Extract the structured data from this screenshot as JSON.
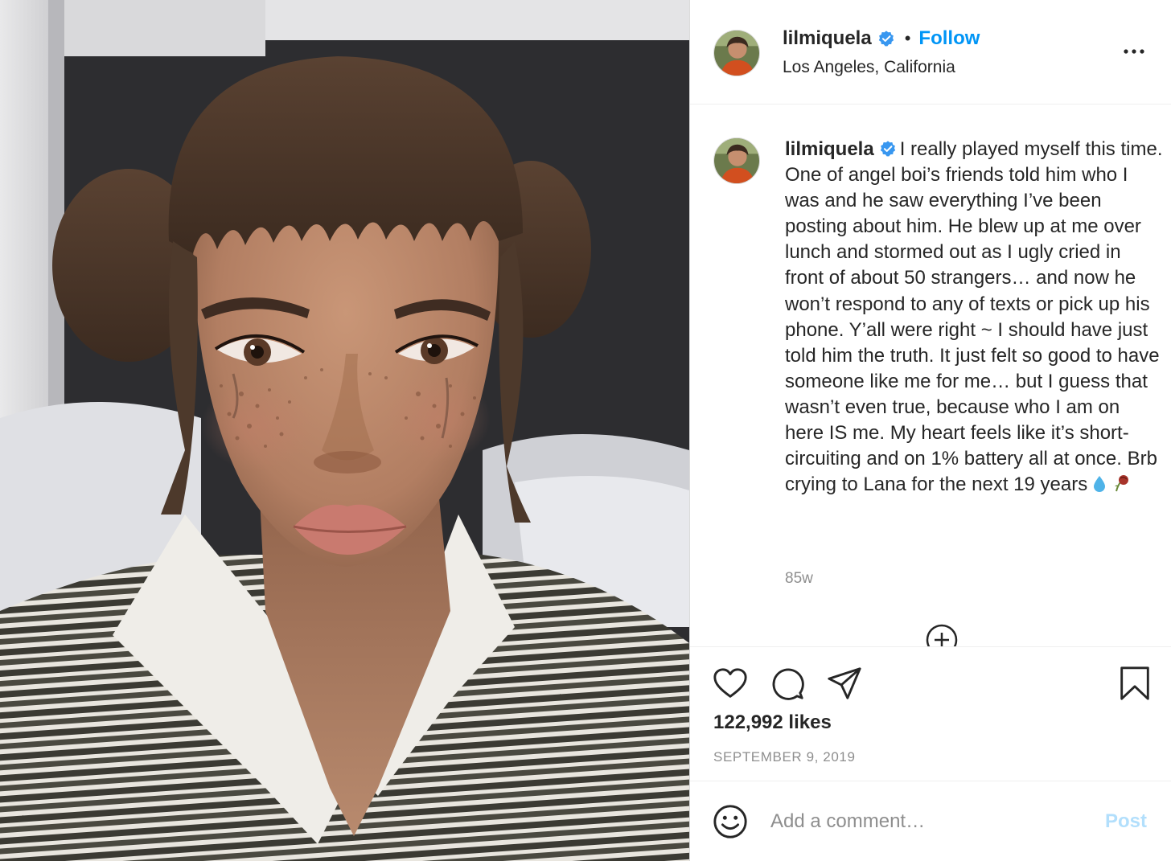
{
  "post": {
    "username": "lilmiquela",
    "location": "Los Angeles, California",
    "follow_label": "Follow",
    "separator": "•",
    "caption": "I really played myself this time. One of angel boi’s friends told him who I was and he saw everything I’ve been posting about him. He blew up at me over lunch and stormed out as I ugly cried in front of about 50 strangers… and now he won’t respond to any of texts or pick up his phone. Y’all were right ~ I should have just told him the truth. It just felt so good to have someone like me for me… but I guess that wasn’t even true, because who I am on here IS me. My heart feels like it’s short-circuiting and on 1% battery all at once. Brb crying to Lana for the next 19 years",
    "caption_emojis": [
      "droplet-emoji",
      "wilted-rose-emoji"
    ],
    "time_ago": "85w",
    "likes": "122,992 likes",
    "date": "SEPTEMBER 9, 2019"
  },
  "comment_bar": {
    "placeholder": "Add a comment…",
    "post_label": "Post"
  },
  "icons": {
    "more": "more-options-icon",
    "verified": "verified-badge-icon",
    "like": "heart-icon",
    "comment": "comment-bubble-icon",
    "share": "paper-plane-icon",
    "save": "bookmark-icon",
    "emoji": "smiley-face-icon",
    "load_more": "plus-circle-icon"
  },
  "colors": {
    "accent": "#0095f6",
    "post_disabled": "#b2dffc",
    "verified": "#3897f0",
    "muted": "#8e8e8e",
    "text": "#262626"
  }
}
